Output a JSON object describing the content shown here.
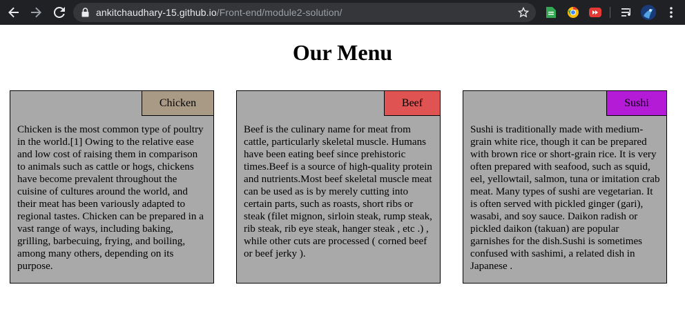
{
  "browser": {
    "url_host": "ankitchaudhary-15.github.io",
    "url_path": "/Front-end/module2-solution/"
  },
  "page": {
    "title": "Our Menu"
  },
  "cards": [
    {
      "tag": "Chicken",
      "tag_color": "#a99a86",
      "text": "Chicken is the most common type of poultry in the world.[1] Owing to the relative ease and low cost of raising them in comparison to animals such as cattle or hogs, chickens have become prevalent throughout the cuisine of cultures around the world, and their meat has been variously adapted to regional tastes. Chicken can be prepared in a vast range of ways, including baking, grilling, barbecuing, frying, and boiling, among many others, depending on its purpose."
    },
    {
      "tag": "Beef",
      "tag_color": "#e05353",
      "text": "Beef is the culinary name for meat from cattle, particularly skeletal muscle. Humans have been eating beef since prehistoric times.Beef is a source of high-quality protein and nutrients.Most beef skeletal muscle meat can be used as is by merely cutting into certain parts, such as roasts, short ribs or steak (filet mignon, sirloin steak, rump steak, rib steak, rib eye steak, hanger steak , etc .) , while other cuts are processed ( corned beef or beef jerky )."
    },
    {
      "tag": "Sushi",
      "tag_color": "#b31bd6",
      "text": "Sushi is traditionally made with medium-grain white rice, though it can be prepared with brown rice or short-grain rice. It is very often prepared with seafood, such as squid, eel, yellowtail, salmon, tuna or imitation crab meat. Many types of sushi are vegetarian. It is often served with pickled ginger (gari), wasabi, and soy sauce. Daikon radish or pickled daikon (takuan) are popular garnishes for the dish.Sushi is sometimes confused with sashimi, a related dish in Japanese ."
    }
  ],
  "colors": {
    "card_background": "#a9a9a9",
    "chrome_background": "#202124"
  }
}
